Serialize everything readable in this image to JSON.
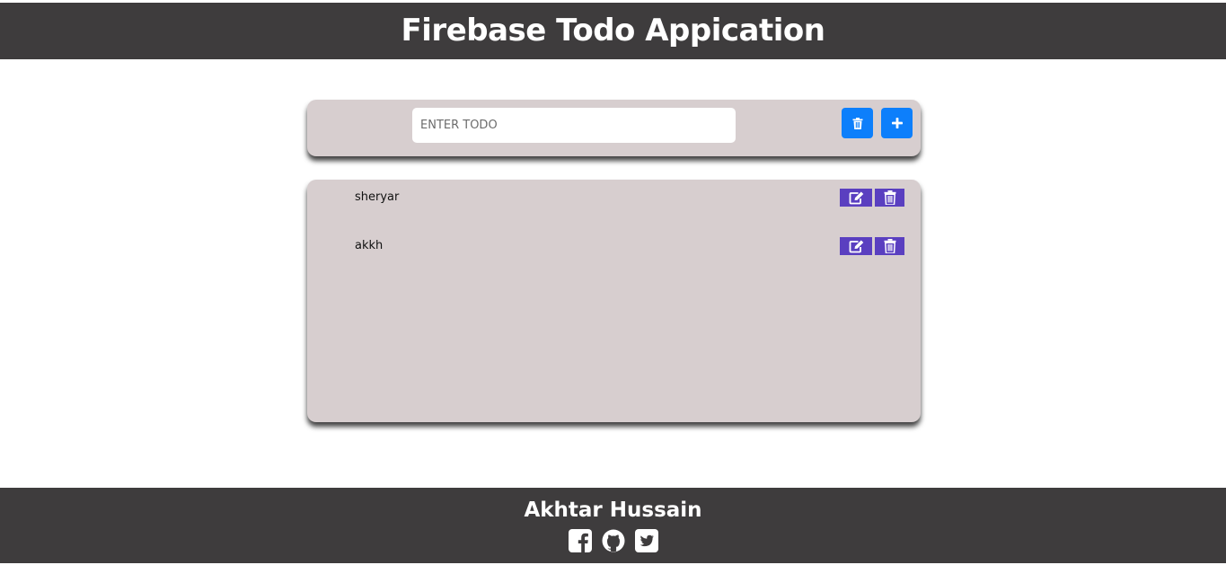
{
  "header": {
    "title": "Firebase Todo Appication"
  },
  "input_card": {
    "placeholder": "ENTER TODO",
    "value": "",
    "delete_all_icon": "trash-icon",
    "add_icon": "plus-icon"
  },
  "todos": [
    {
      "text": "sheryar",
      "edit_icon": "edit-icon",
      "delete_icon": "trash-icon"
    },
    {
      "text": "akkh",
      "edit_icon": "edit-icon",
      "delete_icon": "trash-icon"
    }
  ],
  "footer": {
    "name": "Akhtar Hussain",
    "socials": [
      "facebook-icon",
      "github-icon",
      "twitter-icon"
    ]
  },
  "colors": {
    "header_bg": "#3e3c3d",
    "card_bg": "#d7cecf",
    "primary_button": "#0d7ffb",
    "action_button": "#5a3fc0"
  }
}
